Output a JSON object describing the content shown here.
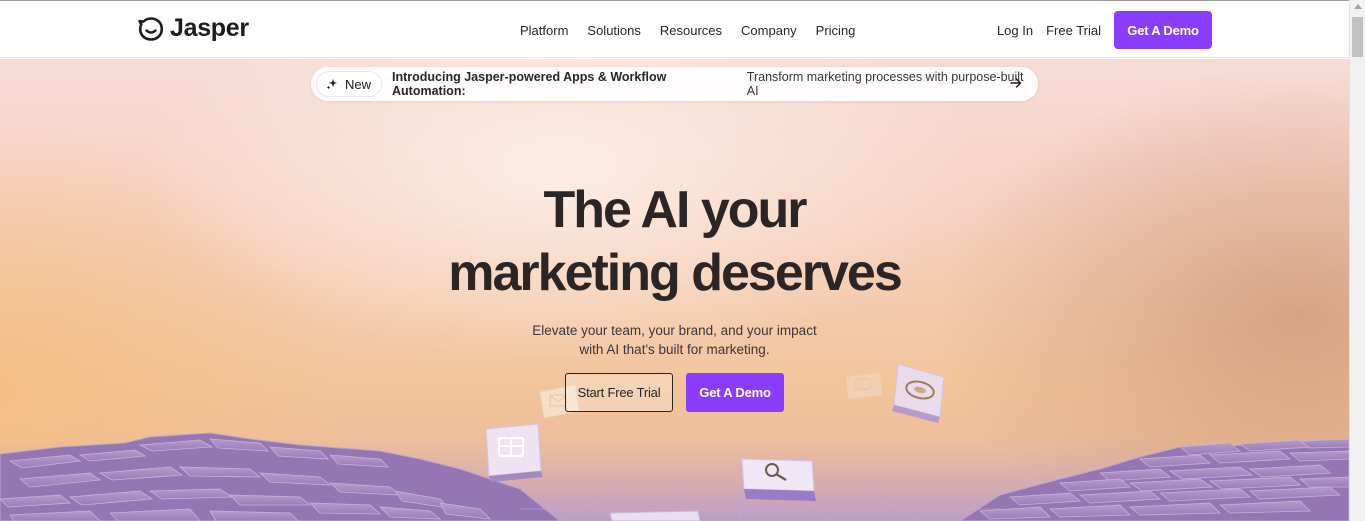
{
  "brand": {
    "name": "Jasper"
  },
  "nav": {
    "items": [
      "Platform",
      "Solutions",
      "Resources",
      "Company",
      "Pricing"
    ],
    "login": "Log In",
    "free_trial": "Free Trial",
    "demo": "Get A Demo"
  },
  "announcement": {
    "badge": "New",
    "bold": "Introducing Jasper-powered Apps & Workflow Automation:",
    "text": "Transform marketing processes with purpose-built AI"
  },
  "hero": {
    "headline_line1": "The AI your",
    "headline_line2": "marketing deserves",
    "sub_line1": "Elevate your team, your brand, and your impact",
    "sub_line2": "with AI that's built for marketing.",
    "cta_primary": "Start Free Trial",
    "cta_secondary": "Get A Demo"
  },
  "colors": {
    "accent": "#8a3dff",
    "text_dark": "#2b2526",
    "block_purple": "#8f74b6"
  },
  "icons": [
    "jasper-logo-icon",
    "sparkle-icon",
    "arrow-right-icon",
    "calendar-tile-icon",
    "search-tile-icon",
    "envelope-tile-icon",
    "chat-tile-icon",
    "seal-tile-icon"
  ]
}
